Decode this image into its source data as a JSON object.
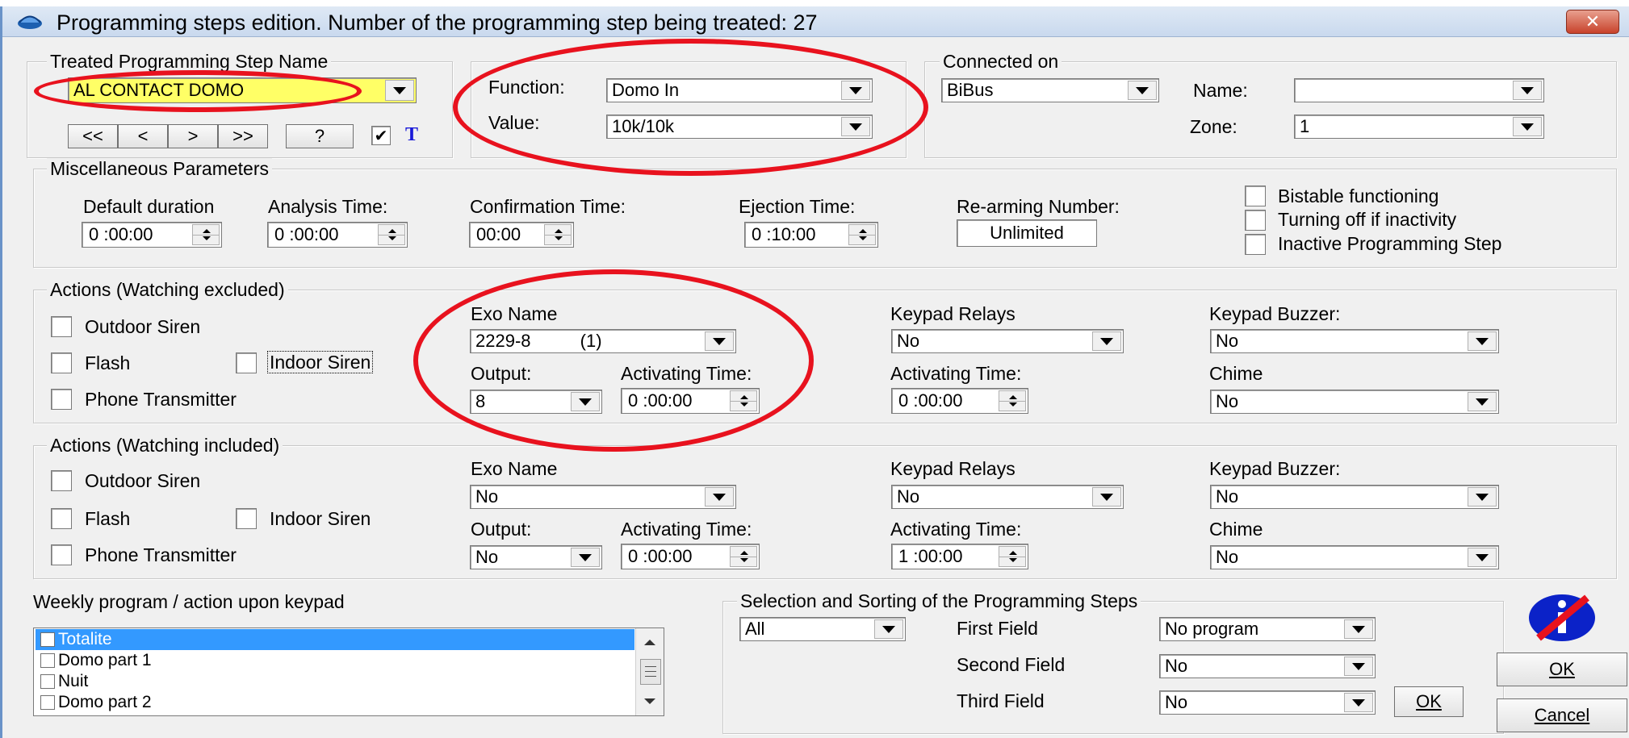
{
  "window": {
    "title": "Programming steps edition.  Number of the programming step being treated: 27",
    "close_label": "✕"
  },
  "step_name": {
    "legend": "Treated Programming Step Name",
    "value": "AL CONTACT DOMO",
    "nav_buttons": [
      "<<",
      "<",
      ">",
      ">>",
      "?"
    ],
    "t_label": "T"
  },
  "function_group": {
    "function_label": "Function:",
    "function_value": "Domo In",
    "value_label": "Value:",
    "value_value": "10k/10k"
  },
  "connected": {
    "legend": "Connected on",
    "bus_value": "BiBus",
    "name_label": "Name:",
    "name_value": "",
    "zone_label": "Zone:",
    "zone_value": "1"
  },
  "misc": {
    "legend": "Miscellaneous Parameters",
    "default_duration_label": "Default duration",
    "default_duration_value": "0 :00:00",
    "analysis_label": "Analysis Time:",
    "analysis_value": "0 :00:00",
    "confirmation_label": "Confirmation Time:",
    "confirmation_value": "00:00",
    "ejection_label": "Ejection Time:",
    "ejection_value": "0 :10:00",
    "rearming_label": "Re-arming Number:",
    "rearming_value": "Unlimited",
    "bistable_label": "Bistable functioning",
    "turning_off_label": "Turning off if inactivity",
    "inactive_label": "Inactive Programming Step"
  },
  "actions_excluded": {
    "legend": "Actions (Watching excluded)",
    "outdoor_siren": "Outdoor Siren",
    "flash": "Flash",
    "indoor_siren": "Indoor Siren",
    "phone_transmitter": "Phone Transmitter",
    "exo_name_label": "Exo Name",
    "exo_name_value": "2229-8          (1)",
    "output_label": "Output:",
    "output_value": "8",
    "activating_label": "Activating Time:",
    "activating_value": "0 :00:00",
    "keypad_relays_label": "Keypad Relays",
    "keypad_relays_value": "No",
    "kr_activating_label": "Activating Time:",
    "kr_activating_value": "0 :00:00",
    "keypad_buzzer_label": "Keypad Buzzer:",
    "keypad_buzzer_value": "No",
    "chime_label": "Chime",
    "chime_value": "No"
  },
  "actions_included": {
    "legend": "Actions (Watching included)",
    "outdoor_siren": "Outdoor Siren",
    "flash": "Flash",
    "indoor_siren": "Indoor Siren",
    "phone_transmitter": "Phone Transmitter",
    "exo_name_label": "Exo Name",
    "exo_name_value": "No",
    "output_label": "Output:",
    "output_value": "No",
    "activating_label": "Activating Time:",
    "activating_value": "0 :00:00",
    "keypad_relays_label": "Keypad Relays",
    "keypad_relays_value": "No",
    "kr_activating_label": "Activating Time:",
    "kr_activating_value": "1 :00:00",
    "keypad_buzzer_label": "Keypad Buzzer:",
    "keypad_buzzer_value": "No",
    "chime_label": "Chime",
    "chime_value": "No"
  },
  "weekly": {
    "label": "Weekly program / action upon keypad",
    "items": [
      "Totalite",
      "Domo part 1",
      "Nuit",
      "Domo part 2"
    ]
  },
  "sorting": {
    "legend": "Selection and Sorting of the Programming Steps",
    "selection_value": "All",
    "first_label": "First Field",
    "first_value": "No program",
    "second_label": "Second Field",
    "second_value": "No",
    "third_label": "Third Field",
    "third_value": "No",
    "ok_label": "OK"
  },
  "dialog_buttons": {
    "ok_label": "OK",
    "cancel_label": "Cancel"
  },
  "colors": {
    "highlight_yellow": "#ffff66",
    "annotation_red": "#e8121e",
    "selection_blue": "#3399ff"
  }
}
